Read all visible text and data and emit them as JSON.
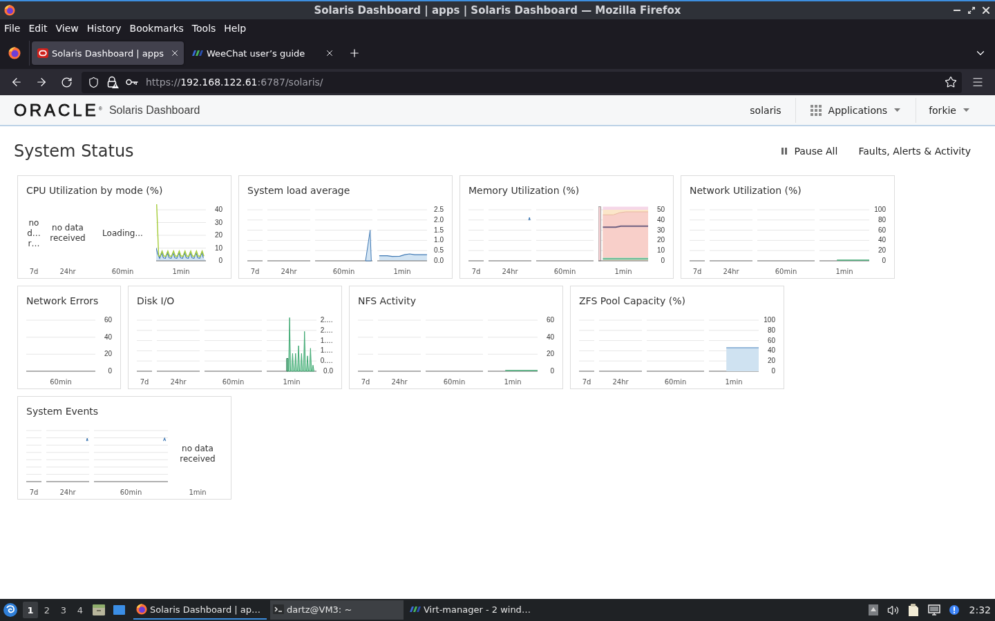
{
  "window": {
    "title": "Solaris Dashboard | apps | Solaris Dashboard — Mozilla Firefox"
  },
  "menu": [
    "File",
    "Edit",
    "View",
    "History",
    "Bookmarks",
    "Tools",
    "Help"
  ],
  "tabs": [
    {
      "label": "Solaris Dashboard | apps",
      "selected": true
    },
    {
      "label": "WeeChat user’s guide",
      "selected": false
    }
  ],
  "address": {
    "scheme": "https://",
    "host": "192.168.122.61",
    "path": ":6787/solaris/"
  },
  "header": {
    "logo": "ORACLE$^{®}$",
    "app_name": "Solaris Dashboard",
    "host": "solaris",
    "applications": "Applications",
    "user": "forkie"
  },
  "page": {
    "title": "System Status",
    "actions": [
      {
        "label": "Pause All",
        "kind": "pause"
      },
      {
        "label": "Faults, Alerts & Activity",
        "kind": "link"
      }
    ]
  },
  "cards": [
    {
      "title": "CPU Utilization by mode (%)",
      "y_ticks": [
        "40",
        "30",
        "20",
        "10",
        "0"
      ],
      "periods": [
        {
          "label": "7d",
          "kind": "message",
          "message": "no d… r…"
        },
        {
          "label": "24hr",
          "kind": "message",
          "message": "no data received"
        },
        {
          "label": "60min",
          "kind": "message",
          "message": "Loading..."
        },
        {
          "label": "1min",
          "kind": "cpu"
        }
      ]
    },
    {
      "title": "System load average",
      "y_ticks": [
        "2.5",
        "2.0",
        "1.5",
        "1.0",
        "0.5",
        "0.0"
      ],
      "periods": [
        {
          "label": "7d",
          "kind": "flat"
        },
        {
          "label": "24hr",
          "kind": "flat"
        },
        {
          "label": "60min",
          "kind": "spike"
        },
        {
          "label": "1min",
          "kind": "wave"
        }
      ]
    },
    {
      "title": "Memory Utilization (%)",
      "y_ticks": [
        "50",
        "40",
        "30",
        "20",
        "10",
        "0"
      ],
      "periods": [
        {
          "label": "7d",
          "kind": "flat"
        },
        {
          "label": "24hr",
          "kind": "blip"
        },
        {
          "label": "60min",
          "kind": "flat"
        },
        {
          "label": "1min",
          "kind": "stacked"
        }
      ]
    },
    {
      "title": "Network Utilization (%)",
      "y_ticks": [
        "100",
        "80",
        "60",
        "40",
        "20",
        "0"
      ],
      "periods": [
        {
          "label": "7d",
          "kind": "flat"
        },
        {
          "label": "24hr",
          "kind": "flat"
        },
        {
          "label": "60min",
          "kind": "flat"
        },
        {
          "label": "1min",
          "kind": "trickle"
        }
      ]
    },
    {
      "title": "Network Errors",
      "y_ticks": [
        "60",
        "40",
        "20",
        "0"
      ],
      "periods": [
        {
          "label": "60min",
          "kind": "flat"
        }
      ]
    },
    {
      "title": "Disk I/O",
      "y_ticks": [
        "2.…",
        "2.…",
        "1.…",
        "1.…",
        "0.…",
        "0.0"
      ],
      "periods": [
        {
          "label": "7d",
          "kind": "flat"
        },
        {
          "label": "24hr",
          "kind": "flat"
        },
        {
          "label": "60min",
          "kind": "flat"
        },
        {
          "label": "1min",
          "kind": "bursts"
        }
      ]
    },
    {
      "title": "NFS Activity",
      "y_ticks": [
        "60",
        "40",
        "20",
        "0"
      ],
      "periods": [
        {
          "label": "7d",
          "kind": "flat"
        },
        {
          "label": "24hr",
          "kind": "flat"
        },
        {
          "label": "60min",
          "kind": "flat"
        },
        {
          "label": "1min",
          "kind": "trickle"
        }
      ]
    },
    {
      "title": "ZFS Pool Capacity (%)",
      "y_ticks": [
        "100",
        "80",
        "60",
        "40",
        "20",
        "0"
      ],
      "periods": [
        {
          "label": "7d",
          "kind": "flat"
        },
        {
          "label": "24hr",
          "kind": "flat"
        },
        {
          "label": "60min",
          "kind": "flat"
        },
        {
          "label": "1min",
          "kind": "block"
        }
      ]
    },
    {
      "title": "System Events",
      "periods": [
        {
          "label": "7d",
          "kind": "flat"
        },
        {
          "label": "24hr",
          "kind": "blip"
        },
        {
          "label": "60min",
          "kind": "blip"
        },
        {
          "label": "1min",
          "kind": "message",
          "message": "no data received"
        }
      ]
    }
  ],
  "taskbar": {
    "workspaces": [
      {
        "label": "1",
        "selected": true
      },
      {
        "label": "2",
        "selected": false
      },
      {
        "label": "3",
        "selected": false
      },
      {
        "label": "4",
        "selected": false
      }
    ],
    "windows": [
      {
        "label": "Solaris Dashboard | ap…",
        "selected": true,
        "highlighted": false
      },
      {
        "label": "dartz@VM3: ~",
        "selected": false,
        "highlighted": true
      },
      {
        "label": "Virt-manager - 2 wind…",
        "selected": false,
        "highlighted": false
      }
    ],
    "clock": "2:32"
  }
}
